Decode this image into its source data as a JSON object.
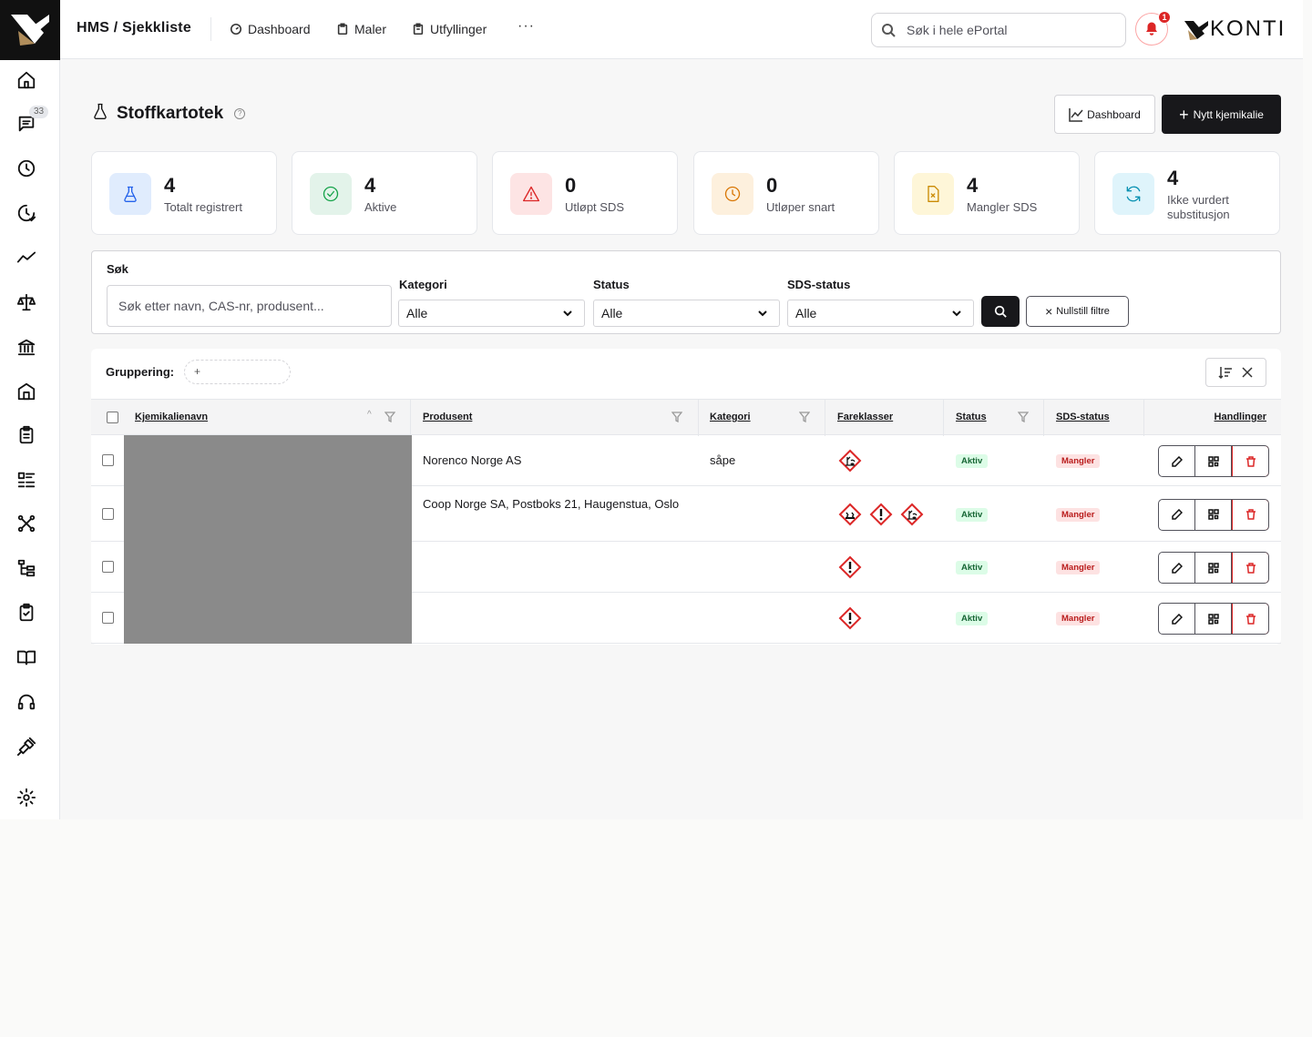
{
  "topbar": {
    "app_title": "HMS / Sjekkliste",
    "nav": [
      "Dashboard",
      "Maler",
      "Utfyllinger"
    ],
    "more": "···",
    "search_placeholder": "Søk i hele ePortal",
    "notification_count": "1",
    "brand": "KONTI"
  },
  "sidebar": {
    "items": [
      "home-icon",
      "messages-icon",
      "clock-icon",
      "clock-check-icon",
      "trend-icon",
      "scale-icon",
      "bank-icon",
      "building-icon",
      "clipboard-icon",
      "list-icon",
      "network-icon",
      "tree-icon",
      "clipboard-check-icon",
      "book-icon",
      "headset-icon",
      "plug-icon",
      "settings-icon"
    ],
    "messages_badge": "33"
  },
  "page": {
    "title": "Stoffkartotek",
    "help": "?",
    "dashboard_button": "Dashboard",
    "new_button": "Nytt kjemikalie"
  },
  "stats": [
    {
      "value": "4",
      "label": "Totalt registrert",
      "icon": "flask-icon",
      "bg": "#e0ecfd",
      "color": "#2563eb"
    },
    {
      "value": "4",
      "label": "Aktive",
      "icon": "check-circle-icon",
      "bg": "#e3f3ea",
      "color": "#16a34a"
    },
    {
      "value": "0",
      "label": "Utløpt SDS",
      "icon": "warning-icon",
      "bg": "#fde4e4",
      "color": "#dc2626"
    },
    {
      "value": "0",
      "label": "Utløper snart",
      "icon": "clock-icon",
      "bg": "#fdf0dd",
      "color": "#d97706"
    },
    {
      "value": "4",
      "label": "Mangler SDS",
      "icon": "file-x-icon",
      "bg": "#fef6d8",
      "color": "#ca8a04"
    },
    {
      "value": "4",
      "label": "Ikke vurdert substitusjon",
      "icon": "refresh-icon",
      "bg": "#dff4fb",
      "color": "#0891b2"
    }
  ],
  "filters": {
    "search_label": "Søk",
    "search_placeholder": "Søk etter navn, CAS-nr, produsent...",
    "category_label": "Kategori",
    "category_value": "Alle",
    "status_label": "Status",
    "status_value": "Alle",
    "sds_label": "SDS-status",
    "sds_value": "Alle",
    "reset_label": "Nullstill filtre"
  },
  "table": {
    "grouping_label": "Gruppering:",
    "grouping_add": "+",
    "columns": [
      "Kjemikalienavn",
      "Produsent",
      "Kategori",
      "Fareklasser",
      "Status",
      "SDS-status",
      "Handlinger"
    ],
    "rows": [
      {
        "producer": "Norenco Norge AS",
        "category": "såpe",
        "hazards": [
          "environment"
        ],
        "status": "Aktiv",
        "sds": "Mangler"
      },
      {
        "producer": "Coop Norge SA, Postboks 21, Haugenstua, Oslo",
        "category": "",
        "hazards": [
          "corrosive",
          "exclamation",
          "environment"
        ],
        "status": "Aktiv",
        "sds": "Mangler"
      },
      {
        "producer": "",
        "category": "",
        "hazards": [
          "exclamation"
        ],
        "status": "Aktiv",
        "sds": "Mangler"
      },
      {
        "producer": "",
        "category": "",
        "hazards": [
          "exclamation"
        ],
        "status": "Aktiv",
        "sds": "Mangler"
      }
    ]
  }
}
